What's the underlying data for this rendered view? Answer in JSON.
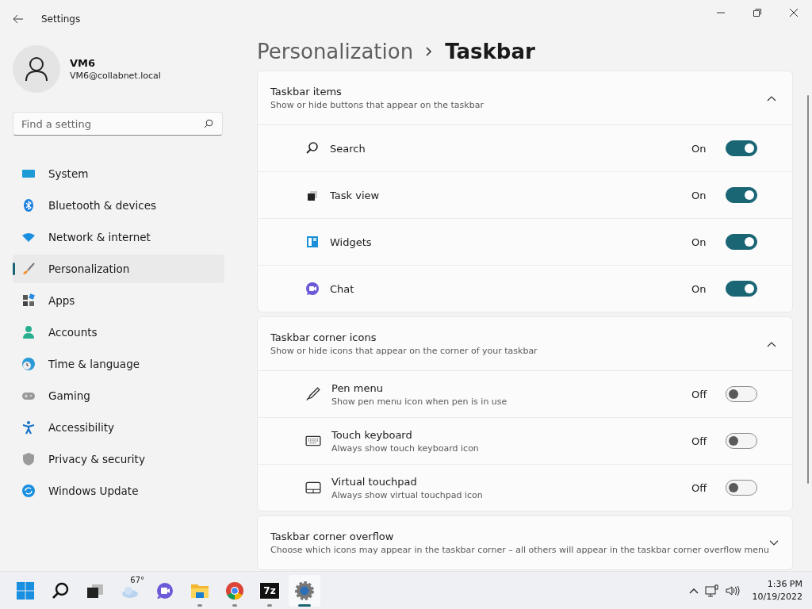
{
  "window": {
    "title": "Settings"
  },
  "user": {
    "name": "VM6",
    "email": "VM6@collabnet.local"
  },
  "search": {
    "placeholder": "Find a setting"
  },
  "nav": [
    {
      "label": "System",
      "selected": false
    },
    {
      "label": "Bluetooth & devices",
      "selected": false
    },
    {
      "label": "Network & internet",
      "selected": false
    },
    {
      "label": "Personalization",
      "selected": true
    },
    {
      "label": "Apps",
      "selected": false
    },
    {
      "label": "Accounts",
      "selected": false
    },
    {
      "label": "Time & language",
      "selected": false
    },
    {
      "label": "Gaming",
      "selected": false
    },
    {
      "label": "Accessibility",
      "selected": false
    },
    {
      "label": "Privacy & security",
      "selected": false
    },
    {
      "label": "Windows Update",
      "selected": false
    }
  ],
  "breadcrumb": {
    "parent": "Personalization",
    "current": "Taskbar"
  },
  "sections": [
    {
      "title": "Taskbar items",
      "description": "Show or hide buttons that appear on the taskbar",
      "expanded": true,
      "items": [
        {
          "label": "Search",
          "state": "On",
          "on": true
        },
        {
          "label": "Task view",
          "state": "On",
          "on": true
        },
        {
          "label": "Widgets",
          "state": "On",
          "on": true
        },
        {
          "label": "Chat",
          "state": "On",
          "on": true
        }
      ]
    },
    {
      "title": "Taskbar corner icons",
      "description": "Show or hide icons that appear on the corner of your taskbar",
      "expanded": true,
      "items": [
        {
          "label": "Pen menu",
          "description": "Show pen menu icon when pen is in use",
          "state": "Off",
          "on": false
        },
        {
          "label": "Touch keyboard",
          "description": "Always show touch keyboard icon",
          "state": "Off",
          "on": false
        },
        {
          "label": "Virtual touchpad",
          "description": "Always show virtual touchpad icon",
          "state": "Off",
          "on": false
        }
      ]
    },
    {
      "title": "Taskbar corner overflow",
      "description": "Choose which icons may appear in the taskbar corner – all others will appear in the taskbar corner overflow menu",
      "expanded": false
    }
  ],
  "taskbar": {
    "apps": [
      {
        "kind": "start",
        "running": false,
        "selected": false
      },
      {
        "kind": "search",
        "running": false,
        "selected": false
      },
      {
        "kind": "taskview",
        "running": false,
        "selected": false
      },
      {
        "kind": "weather",
        "text": "67°",
        "running": false,
        "selected": false
      },
      {
        "kind": "chat",
        "running": false,
        "selected": false
      },
      {
        "kind": "explorer",
        "running": true,
        "selected": false
      },
      {
        "kind": "chrome",
        "running": true,
        "selected": false
      },
      {
        "kind": "zip",
        "text": "7z",
        "running": true,
        "selected": false
      },
      {
        "kind": "settings",
        "running": true,
        "selected": true
      }
    ],
    "time": "1:36 PM",
    "date": "10/19/2022"
  }
}
